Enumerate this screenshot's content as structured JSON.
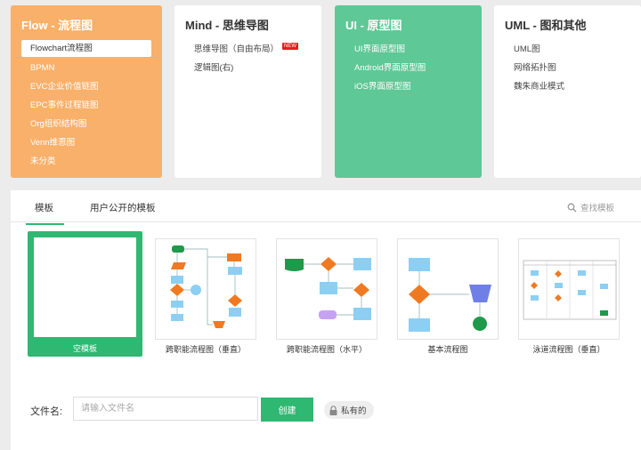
{
  "categories": [
    {
      "title": "Flow - 流程图",
      "items": [
        "Flowchart流程图",
        "BPMN",
        "EVC企业价值链图",
        "EPC事件过程链图",
        "Org组织结构图",
        "Venn维恩图",
        "未分类"
      ]
    },
    {
      "title": "Mind - 思维导图",
      "items": [
        "思维导图（自由布局）",
        "逻辑图(右)"
      ],
      "new_badge": "NEW"
    },
    {
      "title": "UI - 原型图",
      "items": [
        "UI界面原型图",
        "Android界面原型图",
        "iOS界面原型图"
      ]
    },
    {
      "title": "UML - 图和其他",
      "items": [
        "UML图",
        "网络拓扑图",
        "魏朱商业模式"
      ]
    }
  ],
  "tabs": {
    "templates": "模板",
    "public": "用户公开的模板"
  },
  "search": {
    "label": "查找模板",
    "icon": "search-icon"
  },
  "templates": [
    "空模板",
    "跨职能流程图（垂直）",
    "跨职能流程图（水平）",
    "基本流程图",
    "泳道流程图（垂直）"
  ],
  "footer": {
    "label": "文件名:",
    "placeholder": "请输入文件名",
    "create": "创建",
    "private": "私有的"
  },
  "colors": {
    "accent": "#2eb872",
    "flow": "#f9b06a",
    "ui": "#5ec896",
    "shape_green": "#1d9a4a",
    "shape_orange": "#f07a22",
    "shape_blue": "#8ccff3",
    "shape_purple": "#c7a2f2",
    "shape_indigo": "#6f7fe6"
  }
}
